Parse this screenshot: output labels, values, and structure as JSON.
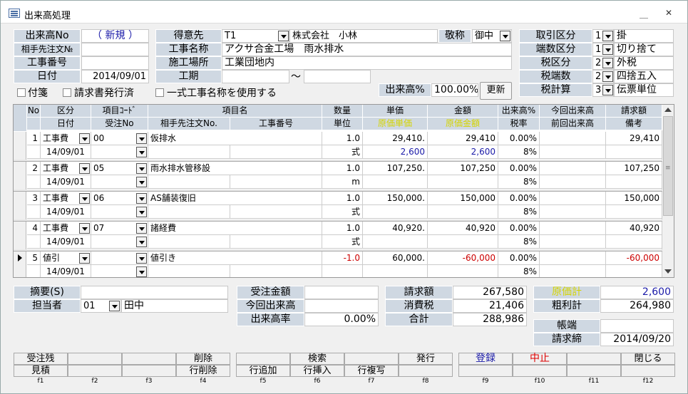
{
  "window": {
    "title": "出来高処理",
    "min": "＿",
    "close": "✕"
  },
  "header": {
    "dekidaka_no_label": "出来高No",
    "dekidaka_no": "（ 新規 ）",
    "aite_label": "相手先注文№",
    "aite": "",
    "kouji_no_label": "工事番号",
    "kouji_no": "",
    "date_label": "日付",
    "date": "2014/09/01",
    "tokui_label": "得意先",
    "tokui_code": "T1",
    "tokui_name": "株式会社　小林",
    "keishou_label": "敬称",
    "keishou": "御中",
    "kouji_name_label": "工事名称",
    "kouji_name": "アクサ合金工場　雨水排水",
    "basho_label": "施工場所",
    "basho": "工業団地内",
    "kouki_label": "工期",
    "kouki_from": "",
    "kouki_sep": "～",
    "kouki_to": "",
    "fusen": "付箋",
    "seikyu_hakko": "請求書発行済",
    "isshiki": "一式工事名称を使用する",
    "dekidaka_rate_label": "出来高%",
    "dekidaka_rate": "100.00%",
    "update": "更新",
    "torihiki_label": "取引区分",
    "torihiki_code": "1",
    "torihiki": "掛",
    "hasuu_label": "端数区分",
    "hasuu_code": "1",
    "hasuu": "切り捨て",
    "zei_label": "税区分",
    "zei_code": "2",
    "zei": "外税",
    "zeihasuu_label": "税端数",
    "zeihasuu_code": "2",
    "zeihasuu": "四捨五入",
    "zeikeisan_label": "税計算",
    "zeikeisan_code": "3",
    "zeikeisan": "伝票単位"
  },
  "grid_header": {
    "row1": [
      "No",
      "区分",
      "項目ｺｰﾄﾞ",
      "項目名",
      "数量",
      "単価",
      "金額",
      "出来高%",
      "今回出来高",
      "請求額"
    ],
    "row2": [
      "日付",
      "受注No",
      "相手先注文No.",
      "工事番号",
      "単位",
      "原価単価",
      "原価金額",
      "税率",
      "前回出来高",
      "備考"
    ]
  },
  "rows": [
    {
      "no": "1",
      "kubun": "工事費",
      "code": "00",
      "name": "仮排水",
      "qty": "1.0",
      "price": "29,410.",
      "amount": "29,410",
      "rate": "0.00%",
      "konkai": "",
      "seikyu": "29,410",
      "date": "14/09/01",
      "unit": "式",
      "genka_tanka": "2,600",
      "genka": "2,600",
      "tax": "8%",
      "neg": false
    },
    {
      "no": "2",
      "kubun": "工事費",
      "code": "05",
      "name": "雨水排水管移設",
      "qty": "1.0",
      "price": "107,250.",
      "amount": "107,250",
      "rate": "0.00%",
      "konkai": "",
      "seikyu": "107,250",
      "date": "14/09/01",
      "unit": "m",
      "genka_tanka": "",
      "genka": "",
      "tax": "8%",
      "neg": false
    },
    {
      "no": "3",
      "kubun": "工事費",
      "code": "06",
      "name": "AS舗装復旧",
      "qty": "1.0",
      "price": "150,000.",
      "amount": "150,000",
      "rate": "0.00%",
      "konkai": "",
      "seikyu": "150,000",
      "date": "14/09/01",
      "unit": "式",
      "genka_tanka": "",
      "genka": "",
      "tax": "8%",
      "neg": false
    },
    {
      "no": "4",
      "kubun": "工事費",
      "code": "07",
      "name": "諸経費",
      "qty": "1.0",
      "price": "40,920.",
      "amount": "40,920",
      "rate": "0.00%",
      "konkai": "",
      "seikyu": "40,920",
      "date": "14/09/01",
      "unit": "式",
      "genka_tanka": "",
      "genka": "",
      "tax": "8%",
      "neg": false
    },
    {
      "no": "5",
      "kubun": "値引",
      "code": "",
      "name": "値引き",
      "qty": "-1.0",
      "price": "60,000.",
      "amount": "-60,000",
      "rate": "0.00%",
      "konkai": "",
      "seikyu": "-60,000",
      "date": "14/09/01",
      "unit": "",
      "genka_tanka": "",
      "genka": "",
      "tax": "8%",
      "neg": true
    }
  ],
  "footer": {
    "tekiyou_label": "摘要(S)",
    "tekiyou": "",
    "tantou_label": "担当者",
    "tantou_code": "01",
    "tantou": "田中",
    "juchu_label": "受注金額",
    "juchu": "",
    "konkai_label": "今回出来高",
    "konkai": "",
    "rate_label": "出来高率",
    "rate": "0.00%",
    "seikyu_label": "請求額",
    "seikyu": "267,580",
    "shohi_label": "消費税",
    "shohi": "21,406",
    "goukei_label": "合計",
    "goukei": "288,986",
    "genka_label": "原価計",
    "genka": "2,600",
    "arari_label": "粗利計",
    "arari": "264,980",
    "chouhasi_label": "帳端",
    "chouhasi": "",
    "shime_label": "請求締",
    "shime": "2014/09/20"
  },
  "fkeys": {
    "top": [
      "受注残",
      "",
      "",
      "削除",
      "",
      "検索",
      "",
      "発行",
      "登録",
      "中止",
      "",
      "閉じる"
    ],
    "bottom": [
      "見積",
      "",
      "",
      "行削除",
      "行追加",
      "行挿入",
      "行複写",
      "",
      "",
      "",
      "",
      ""
    ],
    "labels": [
      "f1",
      "f2",
      "f3",
      "f4",
      "f5",
      "f6",
      "f7",
      "f8",
      "f9",
      "f10",
      "f11",
      "f12"
    ]
  }
}
